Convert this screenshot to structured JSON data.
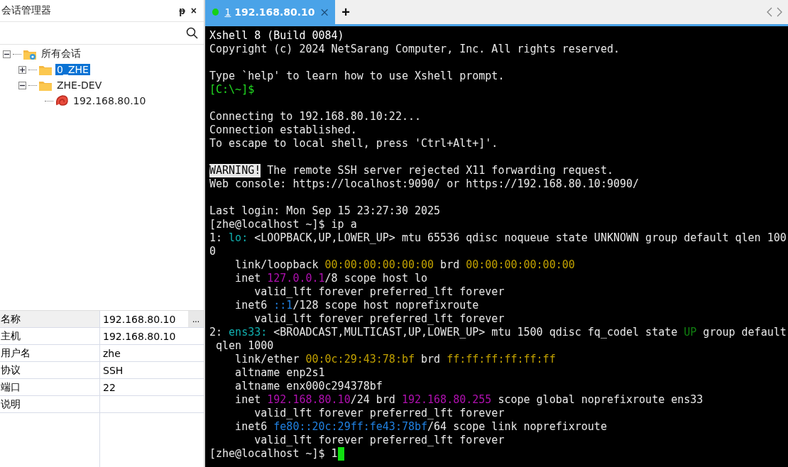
{
  "session_panel": {
    "title": "会话管理器",
    "pin": "ᵽ",
    "close": "×",
    "tree": [
      {
        "label": "所有会话",
        "kind": "root",
        "expanded": true,
        "selected": false,
        "children": [
          {
            "label": "0_ZHE",
            "kind": "folder",
            "expanded": false,
            "selected": true
          },
          {
            "label": "ZHE-DEV",
            "kind": "folder",
            "expanded": true,
            "selected": false,
            "children": [
              {
                "label": "192.168.80.10",
                "kind": "session",
                "selected": false
              }
            ]
          }
        ]
      }
    ],
    "properties": [
      {
        "name": "名称",
        "value": "192.168.80.10",
        "button": "..."
      },
      {
        "name": "主机",
        "value": "192.168.80.10"
      },
      {
        "name": "用户名",
        "value": "zhe"
      },
      {
        "name": "协议",
        "value": "SSH"
      },
      {
        "name": "端口",
        "value": "22"
      },
      {
        "name": "说明"
      }
    ]
  },
  "tabs": [
    {
      "number": "1",
      "label": "192.168.80.10",
      "selected": true,
      "connected": true
    }
  ],
  "new_tab": "+",
  "terminal": {
    "lines": [
      {
        "kind": "text",
        "segments": [
          {
            "text": "Xshell 8 (Build 0084)",
            "color": "#ffffff",
            "inverse": false
          }
        ]
      },
      {
        "kind": "text",
        "segments": [
          {
            "text": "Copyright (c) 2024 NetSarang Computer, Inc. All rights reserved.",
            "color": "#e8e8e8",
            "inverse": false
          }
        ]
      },
      {
        "kind": "blank"
      },
      {
        "kind": "text",
        "segments": [
          {
            "text": "Type `help' to learn how to use Xshell prompt.",
            "color": "#e8e8e8",
            "inverse": false
          }
        ]
      },
      {
        "kind": "text",
        "segments": [
          {
            "text": "[C:\\~]$",
            "color": "#22dd22",
            "inverse": false
          }
        ]
      },
      {
        "kind": "blank"
      },
      {
        "kind": "text",
        "segments": [
          {
            "text": "Connecting to 192.168.80.10:22...",
            "color": "#e8e8e8",
            "inverse": false
          }
        ]
      },
      {
        "kind": "text",
        "segments": [
          {
            "text": "Connection established.",
            "color": "#e8e8e8",
            "inverse": false
          }
        ]
      },
      {
        "kind": "text",
        "segments": [
          {
            "text": "To escape to local shell, press 'Ctrl+Alt+]'.",
            "color": "#e8e8e8",
            "inverse": false
          }
        ]
      },
      {
        "kind": "blank"
      },
      {
        "kind": "text",
        "segments": [
          {
            "text": "WARNING!",
            "color": "#000000",
            "inverse": true
          },
          {
            "text": " The remote SSH server rejected X11 forwarding request.",
            "color": "#e8e8e8",
            "inverse": false
          }
        ]
      },
      {
        "kind": "text",
        "segments": [
          {
            "text": "Web console: https://localhost:9090/ or https://192.168.80.10:9090/",
            "color": "#e8e8e8",
            "inverse": false
          }
        ]
      },
      {
        "kind": "blank"
      },
      {
        "kind": "text",
        "segments": [
          {
            "text": "Last login: Mon Sep 15 23:27:30 2025",
            "color": "#e8e8e8",
            "inverse": false
          }
        ]
      },
      {
        "kind": "text",
        "segments": [
          {
            "text": "[zhe@localhost ~]$ ip a",
            "color": "#e8e8e8",
            "inverse": false
          }
        ]
      },
      {
        "kind": "text",
        "segments": [
          {
            "text": "1: ",
            "color": "#e8e8e8",
            "inverse": false
          },
          {
            "text": "lo:",
            "color": "#10b0b0",
            "inverse": false
          },
          {
            "text": " <LOOPBACK,UP,LOWER_UP> mtu 65536 qdisc noqueue state UNKNOWN group default qlen 100",
            "color": "#e8e8e8",
            "inverse": false
          }
        ]
      },
      {
        "kind": "text",
        "segments": [
          {
            "text": "0",
            "color": "#e8e8e8",
            "inverse": false
          }
        ]
      },
      {
        "kind": "text",
        "segments": [
          {
            "text": "    link/loopback ",
            "color": "#e8e8e8",
            "inverse": false
          },
          {
            "text": "00:00:00:00:00:00",
            "color": "#c0a000",
            "inverse": false
          },
          {
            "text": " brd ",
            "color": "#e8e8e8",
            "inverse": false
          },
          {
            "text": "00:00:00:00:00:00",
            "color": "#c0a000",
            "inverse": false
          }
        ]
      },
      {
        "kind": "text",
        "segments": [
          {
            "text": "    inet ",
            "color": "#e8e8e8",
            "inverse": false
          },
          {
            "text": "127.0.0.1",
            "color": "#b010b0",
            "inverse": false
          },
          {
            "text": "/8 scope host lo",
            "color": "#e8e8e8",
            "inverse": false
          }
        ]
      },
      {
        "kind": "text",
        "segments": [
          {
            "text": "       valid_lft forever preferred_lft forever",
            "color": "#e8e8e8",
            "inverse": false
          }
        ]
      },
      {
        "kind": "text",
        "segments": [
          {
            "text": "    inet6 ",
            "color": "#e8e8e8",
            "inverse": false
          },
          {
            "text": "::1",
            "color": "#2080e0",
            "inverse": false
          },
          {
            "text": "/128 scope host noprefixroute",
            "color": "#e8e8e8",
            "inverse": false
          }
        ]
      },
      {
        "kind": "text",
        "segments": [
          {
            "text": "       valid_lft forever preferred_lft forever",
            "color": "#e8e8e8",
            "inverse": false
          }
        ]
      },
      {
        "kind": "text",
        "segments": [
          {
            "text": "2: ",
            "color": "#e8e8e8",
            "inverse": false
          },
          {
            "text": "ens33:",
            "color": "#10b0b0",
            "inverse": false
          },
          {
            "text": " <BROADCAST,MULTICAST,UP,LOWER_UP> mtu 1500 qdisc fq_codel state ",
            "color": "#e8e8e8",
            "inverse": false
          },
          {
            "text": "UP",
            "color": "#108010",
            "inverse": false
          },
          {
            "text": " group default",
            "color": "#e8e8e8",
            "inverse": false
          }
        ]
      },
      {
        "kind": "text",
        "segments": [
          {
            "text": " qlen 1000",
            "color": "#e8e8e8",
            "inverse": false
          }
        ]
      },
      {
        "kind": "text",
        "segments": [
          {
            "text": "    link/ether ",
            "color": "#e8e8e8",
            "inverse": false
          },
          {
            "text": "00:0c:29:43:78:bf",
            "color": "#c0a000",
            "inverse": false
          },
          {
            "text": " brd ",
            "color": "#e8e8e8",
            "inverse": false
          },
          {
            "text": "ff:ff:ff:ff:ff:ff",
            "color": "#c0a000",
            "inverse": false
          }
        ]
      },
      {
        "kind": "text",
        "segments": [
          {
            "text": "    altname enp2s1",
            "color": "#e8e8e8",
            "inverse": false
          }
        ]
      },
      {
        "kind": "text",
        "segments": [
          {
            "text": "    altname enx000c294378bf",
            "color": "#e8e8e8",
            "inverse": false
          }
        ]
      },
      {
        "kind": "text",
        "segments": [
          {
            "text": "    inet ",
            "color": "#e8e8e8",
            "inverse": false
          },
          {
            "text": "192.168.80.10",
            "color": "#b010b0",
            "inverse": false
          },
          {
            "text": "/24 brd ",
            "color": "#e8e8e8",
            "inverse": false
          },
          {
            "text": "192.168.80.255",
            "color": "#b010b0",
            "inverse": false
          },
          {
            "text": " scope global noprefixroute ens33",
            "color": "#e8e8e8",
            "inverse": false
          }
        ]
      },
      {
        "kind": "text",
        "segments": [
          {
            "text": "       valid_lft forever preferred_lft forever",
            "color": "#e8e8e8",
            "inverse": false
          }
        ]
      },
      {
        "kind": "text",
        "segments": [
          {
            "text": "    inet6 ",
            "color": "#e8e8e8",
            "inverse": false
          },
          {
            "text": "fe80::20c:29ff:fe43:78bf",
            "color": "#2080e0",
            "inverse": false
          },
          {
            "text": "/64 scope link noprefixroute",
            "color": "#e8e8e8",
            "inverse": false
          }
        ]
      },
      {
        "kind": "text",
        "segments": [
          {
            "text": "       valid_lft forever preferred_lft forever",
            "color": "#e8e8e8",
            "inverse": false
          }
        ]
      },
      {
        "kind": "text",
        "cursor": true,
        "segments": [
          {
            "text": "[zhe@localhost ~]$ 1",
            "color": "#e8e8e8",
            "inverse": false
          }
        ]
      }
    ]
  }
}
